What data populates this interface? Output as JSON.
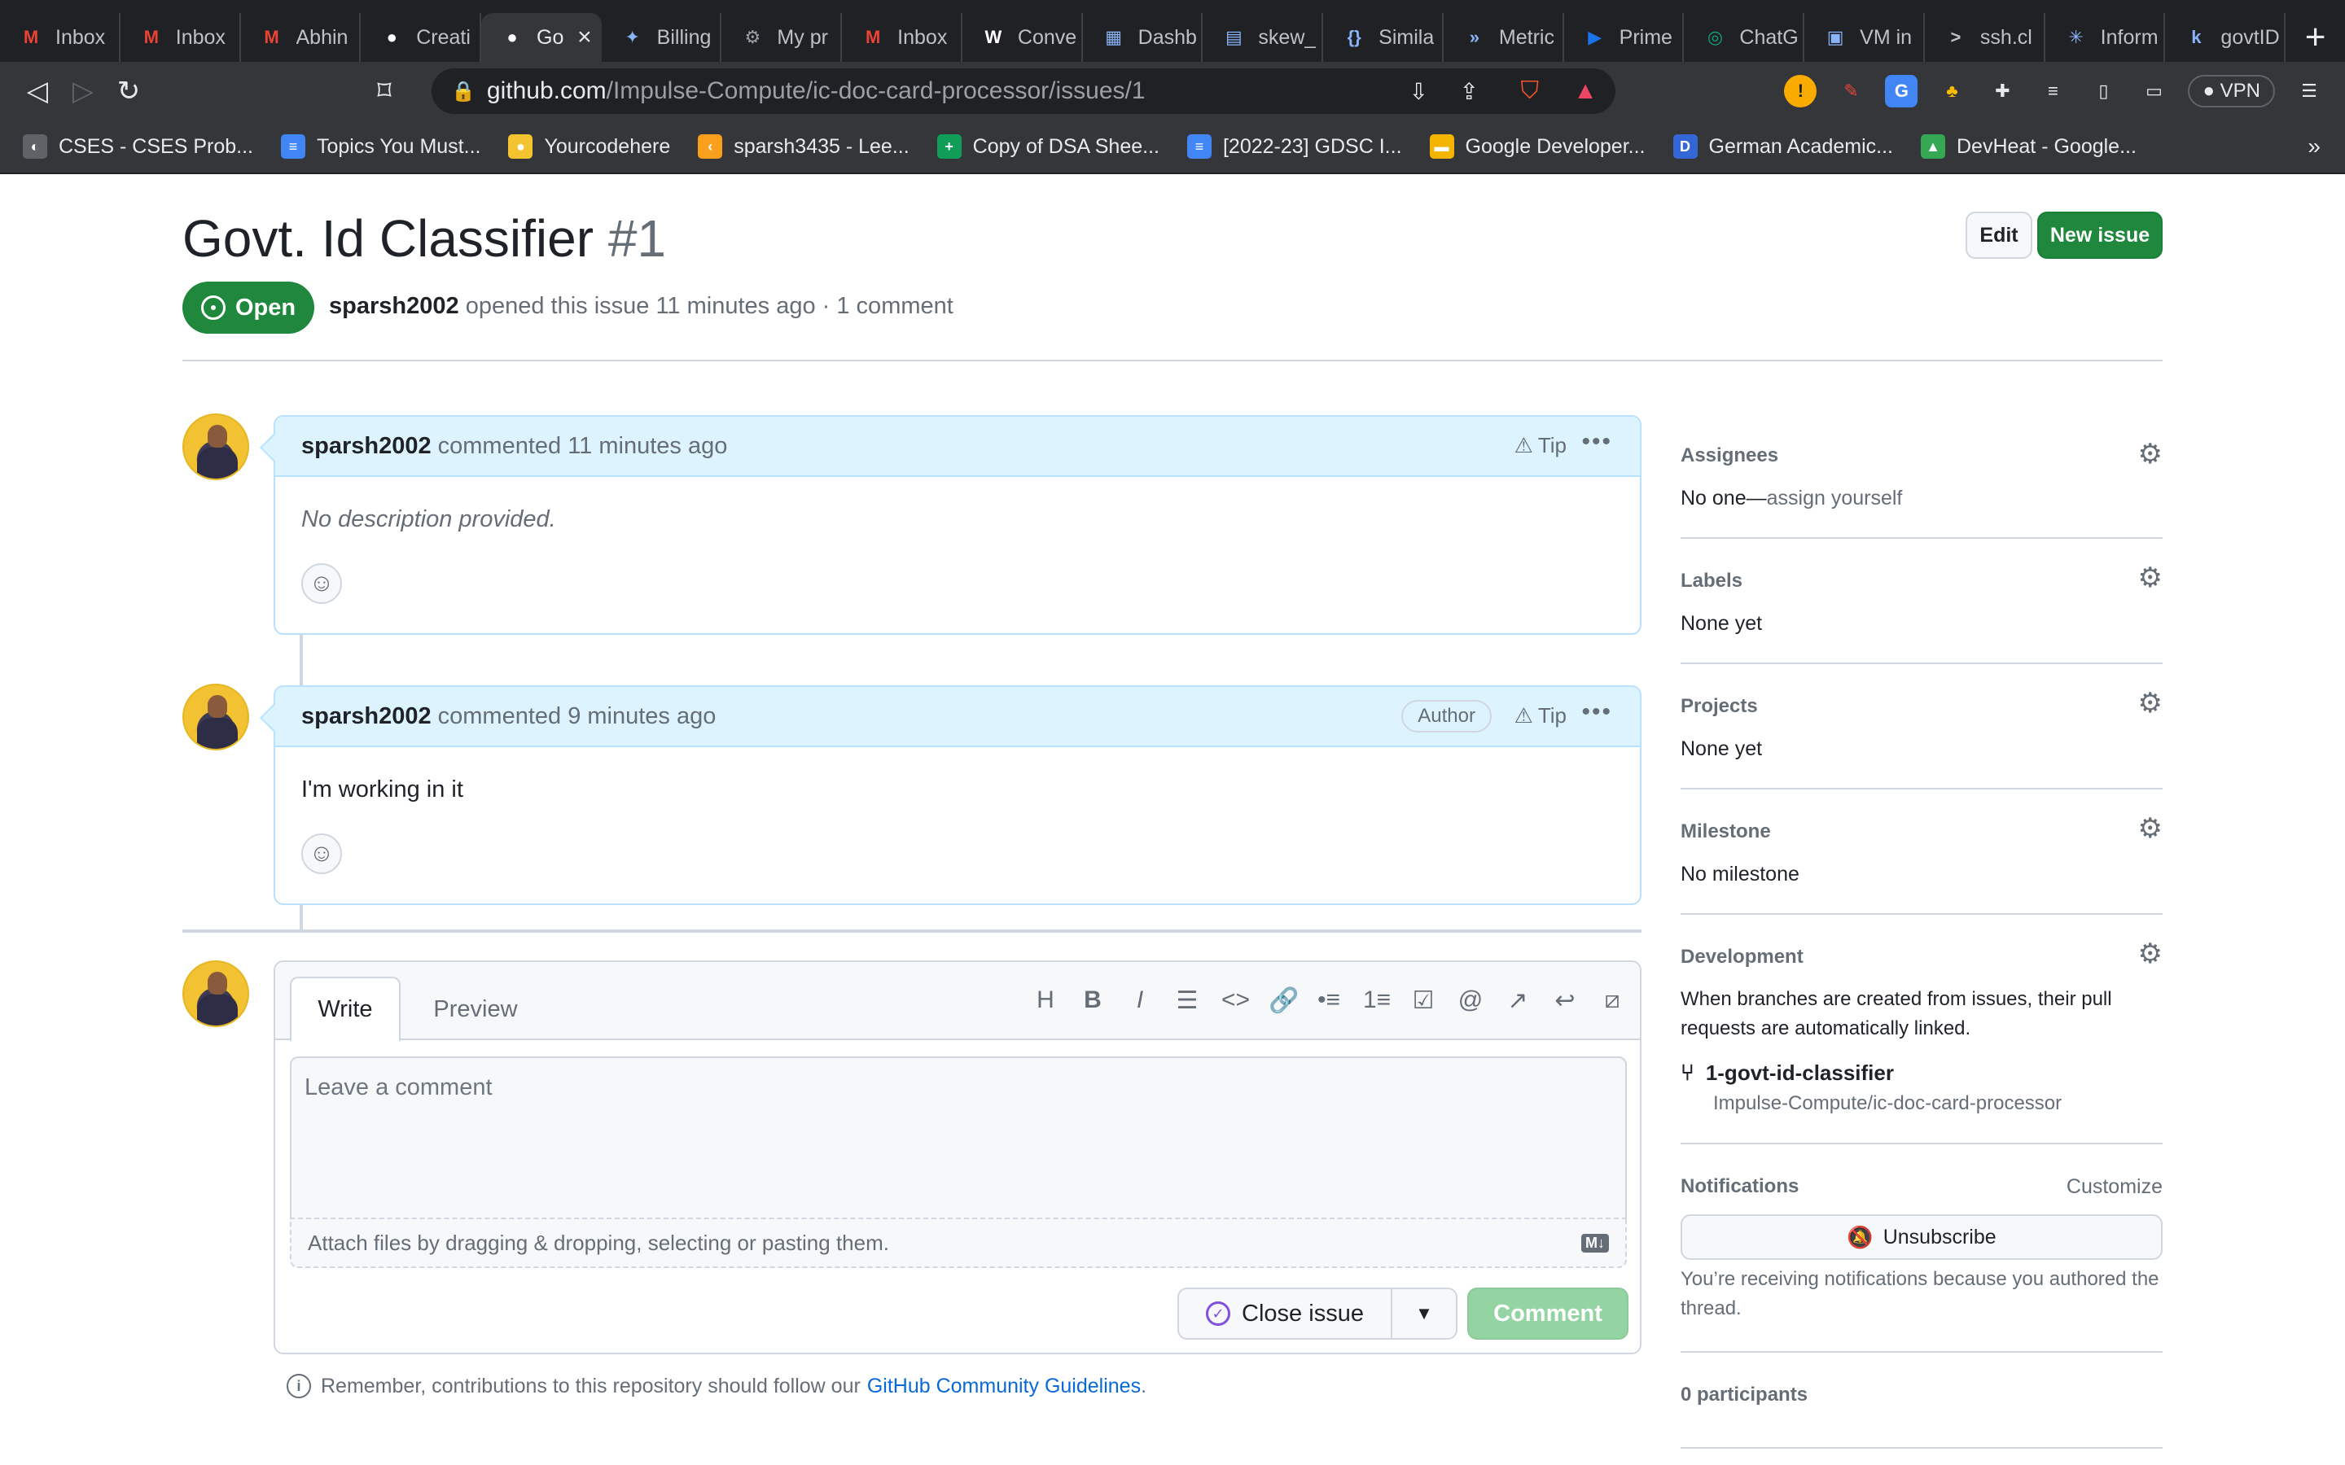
{
  "browser": {
    "tabs": [
      {
        "label": "Inbox",
        "icon": "gmail-icon",
        "color": "#ea4335",
        "glyph": "M"
      },
      {
        "label": "Inbox",
        "icon": "gmail-icon",
        "color": "#ea4335",
        "glyph": "M"
      },
      {
        "label": "Abhin",
        "icon": "gmail-icon",
        "color": "#ea4335",
        "glyph": "M"
      },
      {
        "label": "Creati",
        "icon": "github-icon",
        "color": "#ffffff",
        "glyph": "●"
      },
      {
        "label": "Go",
        "icon": "github-icon",
        "color": "#ffffff",
        "glyph": "●",
        "active": true
      },
      {
        "label": "Billing",
        "icon": "accessibility-icon",
        "color": "#8ab4f8",
        "glyph": "✦"
      },
      {
        "label": "My pr",
        "icon": "openai-icon",
        "color": "#9aa0a6",
        "glyph": "⚙"
      },
      {
        "label": "Inbox",
        "icon": "gmail-icon",
        "color": "#ea4335",
        "glyph": "M"
      },
      {
        "label": "Conve",
        "icon": "w-icon",
        "color": "#ffffff",
        "glyph": "W"
      },
      {
        "label": "Dashb",
        "icon": "dashboard-icon",
        "color": "#8ab4f8",
        "glyph": "▦"
      },
      {
        "label": "skew_",
        "icon": "table-icon",
        "color": "#8ab4f8",
        "glyph": "▤"
      },
      {
        "label": "Simila",
        "icon": "brackets-icon",
        "color": "#8ab4f8",
        "glyph": "{}"
      },
      {
        "label": "Metric",
        "icon": "chevrons-icon",
        "color": "#8ab4f8",
        "glyph": "»"
      },
      {
        "label": "Prime",
        "icon": "prime-icon",
        "color": "#1a73e8",
        "glyph": "▶"
      },
      {
        "label": "ChatG",
        "icon": "chatgpt-icon",
        "color": "#10a37f",
        "glyph": "◎"
      },
      {
        "label": "VM in",
        "icon": "chip-icon",
        "color": "#8ab4f8",
        "glyph": "▣"
      },
      {
        "label": "ssh.cl",
        "icon": "terminal-icon",
        "color": "#bdc1c6",
        "glyph": ">"
      },
      {
        "label": "Inform",
        "icon": "burst-icon",
        "color": "#8ab4f8",
        "glyph": "✳"
      },
      {
        "label": "govtID",
        "icon": "k-icon",
        "color": "#8ab4f8",
        "glyph": "k"
      }
    ],
    "new_tab": "+",
    "url_host": "github.com",
    "url_path": "/Impulse-Compute/ic-doc-card-processor/issues/1",
    "vpn_label": "VPN",
    "bookmarks": [
      {
        "label": "CSES - CSES Prob...",
        "icon": "globe-icon",
        "color": "#5f6368",
        "glyph": "◐"
      },
      {
        "label": "Topics You Must...",
        "icon": "docs-icon",
        "color": "#4285f4",
        "glyph": "≡"
      },
      {
        "label": "Yourcodehere",
        "icon": "yellow-icon",
        "color": "#f4c430",
        "glyph": "●"
      },
      {
        "label": "sparsh3435 - Lee...",
        "icon": "leetcode-icon",
        "color": "#f89f1b",
        "glyph": "‹"
      },
      {
        "label": "Copy of DSA Shee...",
        "icon": "sheets-icon",
        "color": "#0f9d58",
        "glyph": "+"
      },
      {
        "label": "[2022-23] GDSC I...",
        "icon": "docs-icon",
        "color": "#4285f4",
        "glyph": "≡"
      },
      {
        "label": "Google Developer...",
        "icon": "slides-icon",
        "color": "#f4b400",
        "glyph": "▬"
      },
      {
        "label": "German Academic...",
        "icon": "d-icon",
        "color": "#3367d6",
        "glyph": "D"
      },
      {
        "label": "DevHeat - Google...",
        "icon": "drive-icon",
        "color": "#34a853",
        "glyph": "▲"
      }
    ],
    "bookmarks_overflow": "»"
  },
  "issue": {
    "title": "Govt. Id Classifier",
    "number": "#1",
    "edit_label": "Edit",
    "new_issue_label": "New issue",
    "state": "Open",
    "author": "sparsh2002",
    "meta_text": "opened this issue 11 minutes ago · 1 comment"
  },
  "comments": [
    {
      "author": "sparsh2002",
      "action": "commented 11 minutes ago",
      "tip": "Tip",
      "body": "No description provided.",
      "muted": true
    },
    {
      "author": "sparsh2002",
      "action": "commented 9 minutes ago",
      "badge": "Author",
      "tip": "Tip",
      "body": "I'm working in it"
    }
  ],
  "composer": {
    "tab_write": "Write",
    "tab_preview": "Preview",
    "tools": [
      "H",
      "B",
      "I",
      "☰",
      "<>",
      "🔗",
      "•≡",
      "1≡",
      "☑",
      "@",
      "↗",
      "↩",
      "⧄"
    ],
    "placeholder": "Leave a comment",
    "attach_text": "Attach files by dragging & dropping, selecting or pasting them.",
    "md_badge": "M↓",
    "close_issue_label": "Close issue",
    "comment_label": "Comment"
  },
  "guidelines": {
    "text": "Remember, contributions to this repository should follow our",
    "link": "GitHub Community Guidelines",
    "suffix": "."
  },
  "sidebar": {
    "assignees": {
      "heading": "Assignees",
      "value_prefix": "No one—",
      "value_link": "assign yourself"
    },
    "labels": {
      "heading": "Labels",
      "value": "None yet"
    },
    "projects": {
      "heading": "Projects",
      "value": "None yet"
    },
    "milestone": {
      "heading": "Milestone",
      "value": "No milestone"
    },
    "development": {
      "heading": "Development",
      "text": "When branches are created from issues, their pull requests are automatically linked.",
      "branch": "1-govt-id-classifier",
      "repo": "Impulse-Compute/ic-doc-card-processor"
    },
    "notifications": {
      "heading": "Notifications",
      "customize": "Customize",
      "unsubscribe": "Unsubscribe",
      "reason": "You’re receiving notifications because you authored the thread."
    },
    "participants": "0 participants"
  }
}
